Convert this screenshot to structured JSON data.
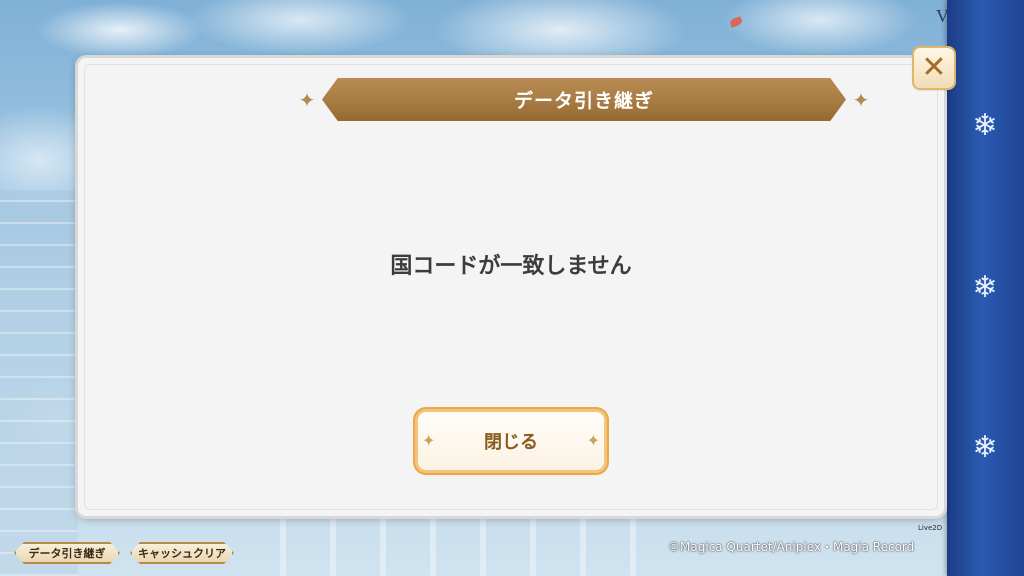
{
  "background": {
    "corner_text": "V"
  },
  "dialog": {
    "title": "データ引き継ぎ",
    "message": "国コードが一致しません",
    "close_button_label": "閉じる",
    "x_icon": "close-icon",
    "x_glyph": "✕"
  },
  "sidebar": {
    "icons": [
      "snowflake-icon",
      "snowflake-icon",
      "snowflake-icon"
    ],
    "glyph": "❄"
  },
  "bottom_bar": {
    "transfer_tab_label": "データ引き継ぎ",
    "cache_clear_tab_label": "キャッシュクリア",
    "copyright": "©Magica Quartet/Aniplex・Magia Record",
    "live2d_label": "Live2D"
  },
  "colors": {
    "title_banner": "#a77b43",
    "button_border": "#e8a94c",
    "sidebar": "#2a5bb0",
    "message_text": "#3c3c3c"
  }
}
